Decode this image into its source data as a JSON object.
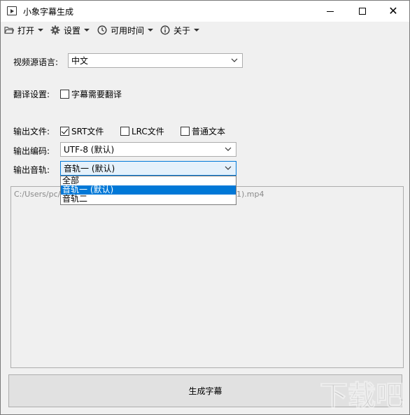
{
  "window": {
    "title": "小象字幕生成"
  },
  "menu": {
    "open": "打开",
    "settings": "设置",
    "time": "可用时间",
    "about": "关于"
  },
  "form": {
    "source_language_label": "视频源语言:",
    "source_language_value": "中文",
    "translate_label": "翻译设置:",
    "translate_checkbox": "字幕需要翻译",
    "output_file_label": "输出文件:",
    "output_srt": "SRT文件",
    "output_lrc": "LRC文件",
    "output_txt": "普通文本",
    "encoding_label": "输出编码:",
    "encoding_value": "UTF-8  (默认)",
    "audio_label": "输出音轨:",
    "audio_value": "音轨一 (默认)"
  },
  "audio_options": [
    "全部",
    "音轨一 (默认)",
    "音轨二"
  ],
  "file_panel": {
    "path_start": "C:/Users/pc/",
    "path_end": "1).mp4"
  },
  "actions": {
    "generate": "生成字幕"
  },
  "watermark_text": "下载吧",
  "colors": {
    "selection": "#0078d7",
    "window_bg": "#f0f0f0"
  }
}
